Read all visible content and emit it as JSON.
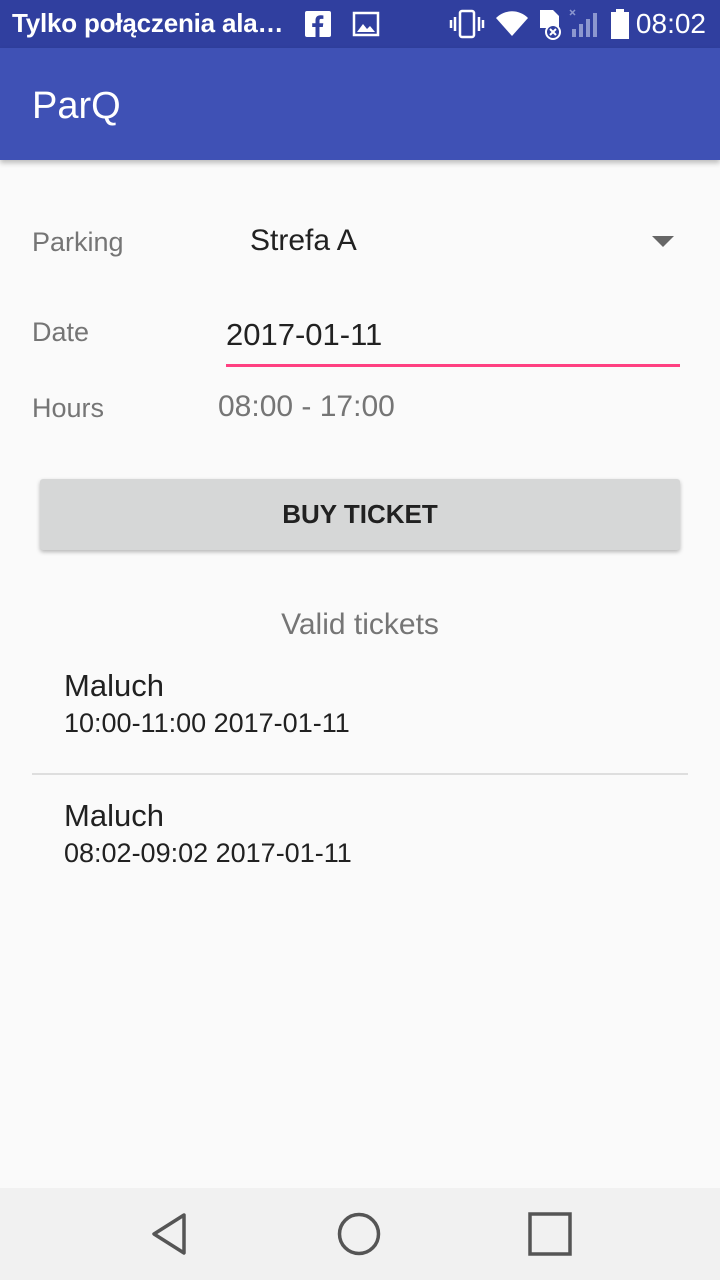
{
  "status_bar": {
    "notification_text": "Tylko połączenia alarmowe",
    "time": "08:02",
    "icons": [
      "facebook-icon",
      "image-icon",
      "vibrate-icon",
      "wifi-icon",
      "sd-card-icon",
      "signal-icon",
      "battery-icon"
    ]
  },
  "app_bar": {
    "title": "ParQ",
    "color": "#3f51b5"
  },
  "form": {
    "parking_label": "Parking",
    "parking_value": "Strefa A",
    "date_label": "Date",
    "date_value": "2017-01-11",
    "hours_label": "Hours",
    "hours_value": "08:00 - 17:00",
    "accent_color": "#ff4081"
  },
  "buy_button": {
    "label": "BUY TICKET"
  },
  "tickets_section": {
    "title": "Valid tickets",
    "items": [
      {
        "name": "Maluch",
        "time": "10:00-11:00 2017-01-11"
      },
      {
        "name": "Maluch",
        "time": "08:02-09:02 2017-01-11"
      }
    ]
  },
  "nav_bar": {
    "icons": [
      "back-icon",
      "home-icon",
      "recents-icon"
    ]
  }
}
